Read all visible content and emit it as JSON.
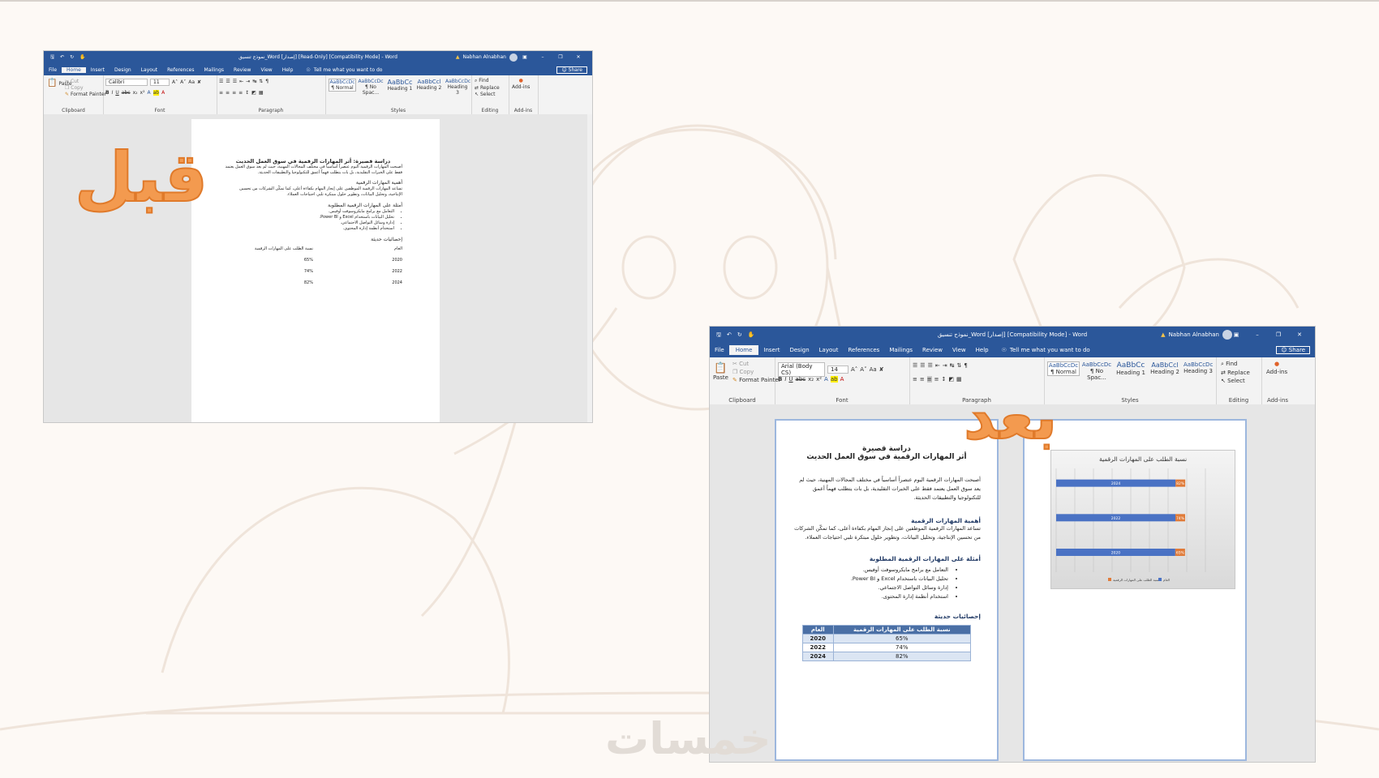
{
  "before_label": "قبل",
  "after_label": "بعد",
  "watermark": "خمسات",
  "ribbon_common": {
    "tabs": [
      "File",
      "Home",
      "Insert",
      "Design",
      "Layout",
      "References",
      "Mailings",
      "Review",
      "View",
      "Help"
    ],
    "tell_me": "Tell me what you want to do",
    "share": "Share",
    "paste": "Paste",
    "cut": "Cut",
    "copy": "Copy",
    "format_painter": "Format Painter",
    "find": "Find",
    "replace": "Replace",
    "select": "Select",
    "addins": "Add-ins",
    "groups": {
      "clipboard": "Clipboard",
      "font": "Font",
      "paragraph": "Paragraph",
      "styles": "Styles",
      "editing": "Editing",
      "addins": "Add-ins"
    },
    "styles": [
      {
        "sample": "AaBbCcDc",
        "name": "¶ Normal"
      },
      {
        "sample": "AaBbCcDc",
        "name": "¶ No Spac..."
      },
      {
        "sample": "AaBbCc",
        "name": "Heading 1"
      },
      {
        "sample": "AaBbCcl",
        "name": "Heading 2"
      },
      {
        "sample": "AaBbCcDc",
        "name": "Heading 3"
      }
    ]
  },
  "before_window": {
    "title": "نموذج تنسيق_Word [إصدار] [Read-Only] [Compatibility Mode]  -  Word",
    "user": "Nabhan Alnabhan",
    "font_name": "Calibri",
    "font_size": "11"
  },
  "after_window": {
    "title": "نموذج تنسيق_Word [إصدار] [Compatibility Mode]  -  Word",
    "user": "Nabhan Alnabhan",
    "font_name": "Arial (Body CS)",
    "font_size": "14"
  },
  "before_doc": {
    "title": "دراسة قصيرة: أثر المهارات الرقمية في سوق العمل الحديث",
    "intro": "أصبحت المهارات الرقمية اليوم عنصراً أساسياً في مختلف المجالات المهنية، حيث لم يعد سوق العمل يعتمد فقط على الخبرات التقليدية، بل بات يتطلب فهماً أعمق للتكنولوجيا والتطبيقات الحديثة.",
    "h_importance": "أهمية المهارات الرقمية",
    "importance": "تساعد المهارات الرقمية الموظفين على إنجاز المهام بكفاءة أعلى، كما تمكّن الشركات من تحسين الإنتاجية، وتحليل البيانات، وتطوير حلول مبتكرة تلبي احتياجات العملاء.",
    "h_examples": "أمثلة على المهارات الرقمية المطلوبة",
    "examples": [
      "التعامل مع برامج مايكروسوفت أوفيس.",
      "تحليل البيانات باستخدام Excel و Power BI.",
      "إدارة وسائل التواصل الاجتماعي.",
      "استخدام أنظمة إدارة المحتوى."
    ],
    "h_stats": "إحصائيات حديثة",
    "col_year": "العام",
    "col_pct": "نسبة الطلب على المهارات الرقمية",
    "rows": [
      [
        "2020",
        "65%"
      ],
      [
        "2022",
        "74%"
      ],
      [
        "2024",
        "82%"
      ]
    ]
  },
  "after_doc": {
    "title_line1": "دراسة قصيرة",
    "title_line2": "أثر المهارات الرقمية في سوق العمل الحديث",
    "intro": "أصبحت المهارات الرقمية اليوم عنصراً أساسياً في مختلف المجالات المهنية، حيث لم يعد سوق العمل يعتمد فقط على الخبرات التقليدية، بل بات يتطلب فهماً أعمق للتكنولوجيا والتطبيقات الحديثة.",
    "h_importance": "أهمية المهارات الرقمية",
    "importance": "تساعد المهارات الرقمية الموظفين على إنجاز المهام بكفاءة أعلى، كما تمكّن الشركات من تحسين الإنتاجية، وتحليل البيانات، وتطوير حلول مبتكرة تلبي احتياجات العملاء.",
    "h_examples": "أمثلة على المهارات الرقمية المطلوبة",
    "examples": [
      "التعامل مع برامج مايكروسوفت أوفيس.",
      "تحليل البيانات باستخدام Excel و Power BI.",
      "إدارة وسائل التواصل الاجتماعي.",
      "استخدام أنظمة إدارة المحتوى."
    ],
    "h_stats": "إحصائيات حديثة",
    "col_pct": "نسبة الطلب على المهارات الرقمية",
    "col_year": "العام",
    "rows": [
      [
        "65%",
        "2020"
      ],
      [
        "74%",
        "2022"
      ],
      [
        "82%",
        "2024"
      ]
    ]
  },
  "chart_data": {
    "type": "bar",
    "title": "نسبة الطلب على المهارات الرقمية",
    "categories": [
      "2024",
      "2022",
      "2020"
    ],
    "series": [
      {
        "name": "العام",
        "values": [
          2024,
          2022,
          2020
        ],
        "color": "#4a72c4"
      },
      {
        "name": "نسبة الطلب على المهارات الرقمية",
        "values": [
          0.82,
          0.74,
          0.65
        ],
        "color": "#e07b39"
      }
    ],
    "legend_position": "bottom"
  }
}
